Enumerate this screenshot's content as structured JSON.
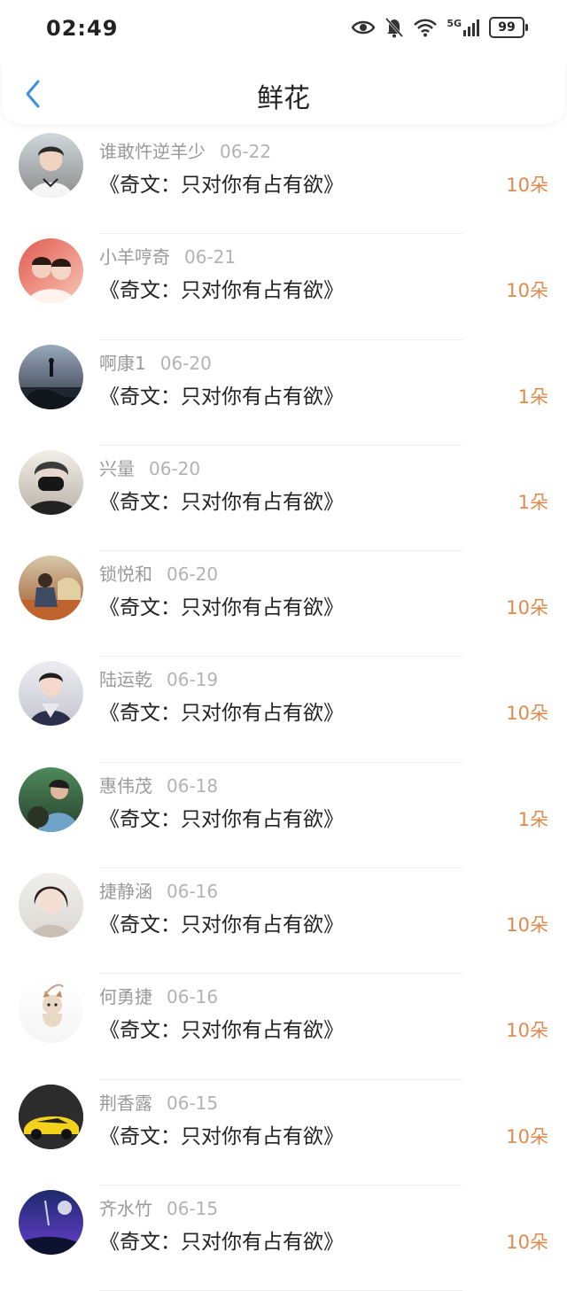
{
  "status_bar": {
    "time": "02:49",
    "network": "5G",
    "battery": "99",
    "icons": [
      "eye-icon",
      "bell-off-icon",
      "wifi-icon",
      "signal-icon",
      "battery-icon"
    ]
  },
  "header": {
    "title": "鲜花",
    "back_icon": "chevron-left-icon"
  },
  "colors": {
    "accent": "#3d8fe0",
    "count": "#e08a4d",
    "meta": "#9a9a9a"
  },
  "items": [
    {
      "name": "谁敢忤逆羊少",
      "date": "06-22",
      "book": "《奇文：只对你有占有欲》",
      "count": "10朵"
    },
    {
      "name": "小羊哼奇",
      "date": "06-21",
      "book": "《奇文：只对你有占有欲》",
      "count": "10朵"
    },
    {
      "name": "啊康1",
      "date": "06-20",
      "book": "《奇文：只对你有占有欲》",
      "count": "1朵"
    },
    {
      "name": "兴量",
      "date": "06-20",
      "book": "《奇文：只对你有占有欲》",
      "count": "1朵"
    },
    {
      "name": "锁悦和",
      "date": "06-20",
      "book": "《奇文：只对你有占有欲》",
      "count": "10朵"
    },
    {
      "name": "陆运乾",
      "date": "06-19",
      "book": "《奇文：只对你有占有欲》",
      "count": "10朵"
    },
    {
      "name": "惠伟茂",
      "date": "06-18",
      "book": "《奇文：只对你有占有欲》",
      "count": "1朵"
    },
    {
      "name": "捷静涵",
      "date": "06-16",
      "book": "《奇文：只对你有占有欲》",
      "count": "10朵"
    },
    {
      "name": "何勇捷",
      "date": "06-16",
      "book": "《奇文：只对你有占有欲》",
      "count": "10朵"
    },
    {
      "name": "荆香露",
      "date": "06-15",
      "book": "《奇文：只对你有占有欲》",
      "count": "10朵"
    },
    {
      "name": "齐水竹",
      "date": "06-15",
      "book": "《奇文：只对你有占有欲》",
      "count": "10朵"
    }
  ]
}
